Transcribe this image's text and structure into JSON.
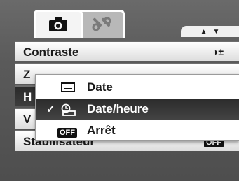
{
  "tabs": [
    {
      "icon": "camera-icon",
      "active": true
    },
    {
      "icon": "wrench-icon",
      "active": false
    }
  ],
  "page_nav": {
    "up_symbol": "▲",
    "down_symbol": "▼"
  },
  "menu_rows": [
    {
      "label": "Contraste",
      "value": "◑±"
    },
    {
      "label": "Z",
      "value": ""
    },
    {
      "label": "H",
      "value": ""
    },
    {
      "label": "V",
      "value": ""
    },
    {
      "label": "Stabilisateur",
      "value": "OFF"
    }
  ],
  "popup_options": [
    {
      "label": "Date",
      "icon": "calendar-icon",
      "checked": false,
      "selected": false
    },
    {
      "label": "Date/heure",
      "icon": "clock-calendar-icon",
      "checked": true,
      "selected": true
    },
    {
      "label": "Arrêt",
      "icon": "off-icon",
      "icon_text": "OFF",
      "checked": false,
      "selected": false
    }
  ],
  "check_symbol": "✓",
  "colors": {
    "highlight": "#2b2b2b",
    "row_bg": "#ffffff",
    "background": "#5a5a5a"
  }
}
